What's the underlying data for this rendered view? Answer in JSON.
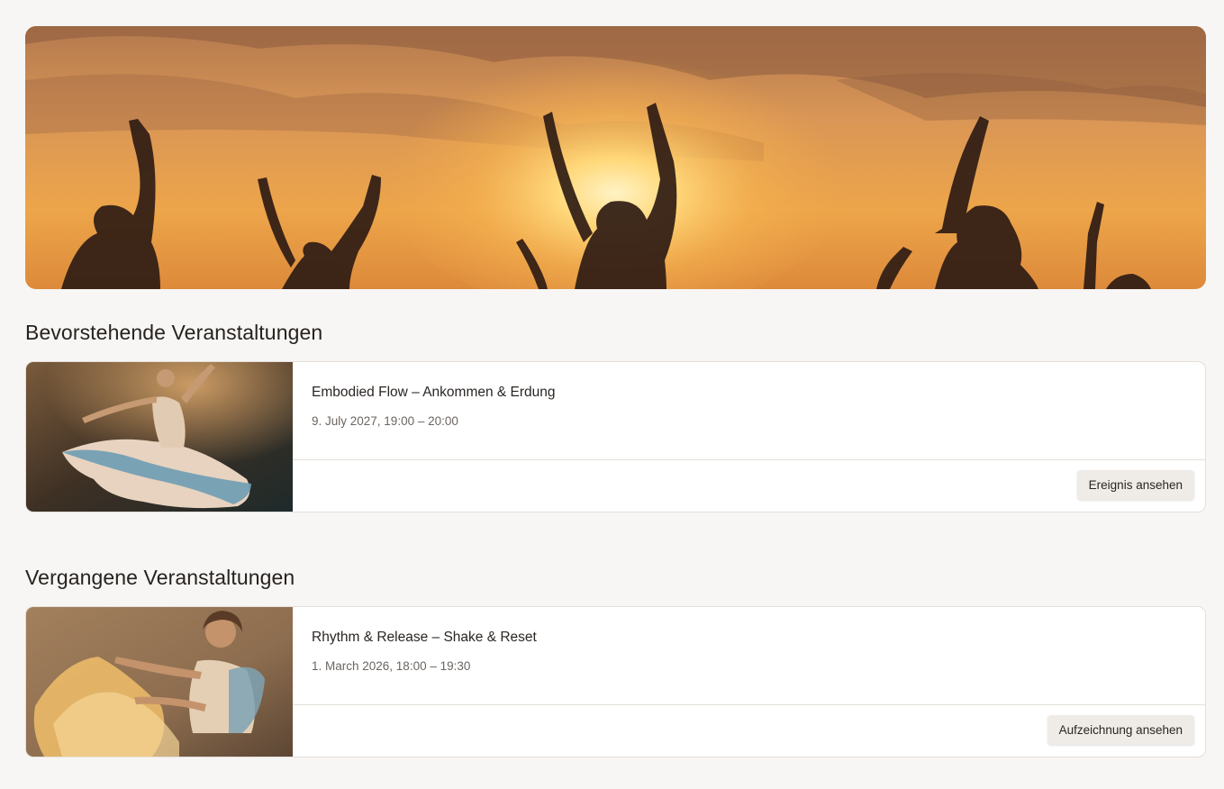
{
  "hero": {
    "image": "sunset-dancers-silhouette"
  },
  "sections": {
    "upcoming": {
      "title": "Bevorstehende Veranstaltungen",
      "events": [
        {
          "image": "dancer-flowing-dress",
          "title": "Embodied Flow – Ankommen & Erdung",
          "date": "9. July 2027, 19:00 – 20:00",
          "button_label": "Ereignis ansehen"
        }
      ]
    },
    "past": {
      "title": "Vergangene Veranstaltungen",
      "events": [
        {
          "image": "dancer-smiling-spinning",
          "title": "Rhythm & Release – Shake & Reset",
          "date": "1. March 2026, 18:00 – 19:30",
          "button_label": "Aufzeichnung ansehen"
        }
      ]
    }
  },
  "colors": {
    "background": "#f8f6f4",
    "card_border": "#e4dfda",
    "button_bg": "#efebe7",
    "sunset_orange": "#e9a04b"
  }
}
